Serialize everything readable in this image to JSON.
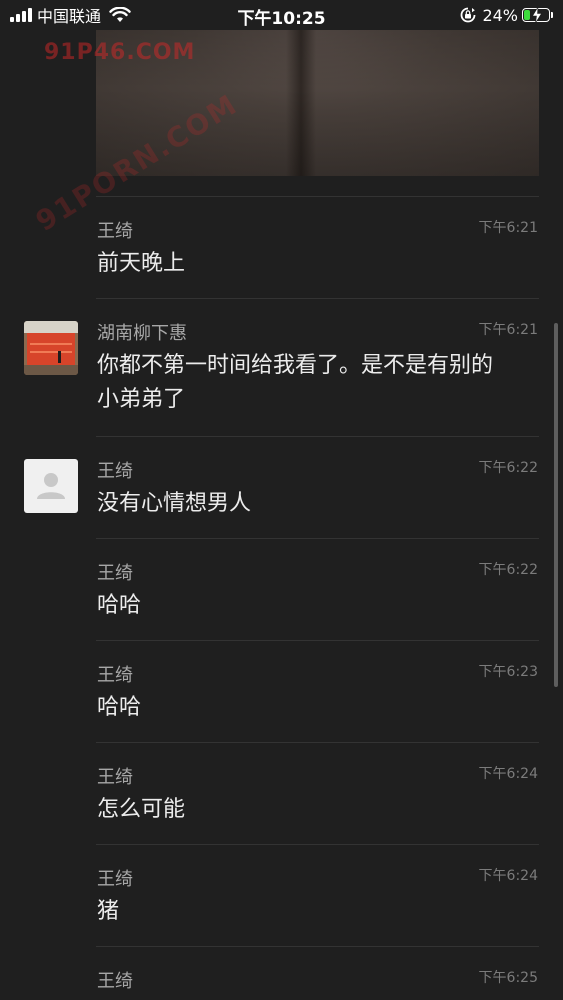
{
  "status_bar": {
    "carrier": "中国联通",
    "time": "下午10:25",
    "battery_percent": "24%",
    "battery_level": 0.24,
    "battery_color": "#3ddc3d"
  },
  "watermark": {
    "main": "91P46.COM",
    "diagonal": "91PORN.COM"
  },
  "messages": [
    {
      "sender": "王绮",
      "time": "下午6:21",
      "text": "前天晚上"
    },
    {
      "sender": "湖南柳下惠",
      "time": "下午6:21",
      "text_line1": "你都不第一时间给我看了。是不是有别的",
      "text_line2": "小弟弟了"
    },
    {
      "sender": "王绮",
      "time": "下午6:22",
      "text": "没有心情想男人"
    },
    {
      "sender": "王绮",
      "time": "下午6:22",
      "text": "哈哈"
    },
    {
      "sender": "王绮",
      "time": "下午6:23",
      "text": "哈哈"
    },
    {
      "sender": "王绮",
      "time": "下午6:24",
      "text": "怎么可能"
    },
    {
      "sender": "王绮",
      "time": "下午6:24",
      "text": "猪"
    },
    {
      "sender": "王绮",
      "time": "下午6:25",
      "text": ""
    }
  ],
  "icons": {
    "signal": "signal-bars-icon",
    "wifi": "wifi-icon",
    "rotation_lock": "rotation-lock-icon",
    "battery": "battery-charging-icon",
    "default_avatar": "person-silhouette-icon"
  }
}
